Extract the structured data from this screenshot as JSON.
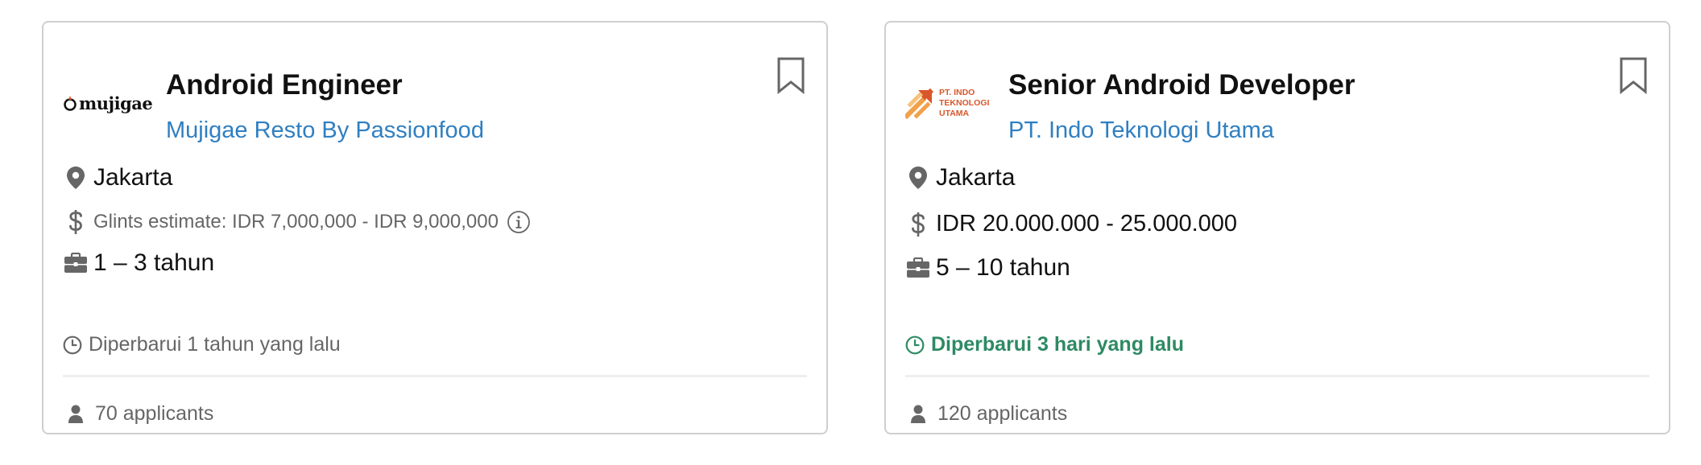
{
  "cards": [
    {
      "logo_text": "mujigae",
      "title": "Android Engineer",
      "company": "Mujigae Resto By Passionfood",
      "location": "Jakarta",
      "salary": "Glints estimate: IDR 7,000,000 - IDR 9,000,000",
      "experience": "1 – 3 tahun",
      "updated": "Diperbarui 1 tahun yang lalu",
      "applicants": "70 applicants"
    },
    {
      "logo_text_lines": [
        "PT. INDO",
        "TEKNOLOGI",
        "UTAMA"
      ],
      "title": "Senior Android Developer",
      "company": "PT. Indo Teknologi Utama",
      "location": "Jakarta",
      "salary": "IDR 20.000.000 - 25.000.000",
      "experience": "5 – 10 tahun",
      "updated": "Diperbarui 3 hari yang lalu",
      "applicants": "120 applicants"
    }
  ],
  "colors": {
    "title": "#111111",
    "company_link": "#2f7fc1",
    "muted_text": "#666666",
    "recent_update": "#2e8a63",
    "icon_gray": "#666666",
    "border": "#cfcfcf",
    "logo_orange": "#d9572b"
  },
  "icons": {
    "location": "map-pin-icon",
    "salary": "dollar-icon",
    "experience": "briefcase-icon",
    "updated": "clock-icon",
    "applicants": "person-icon",
    "info": "info-icon",
    "save": "bookmark-icon"
  }
}
